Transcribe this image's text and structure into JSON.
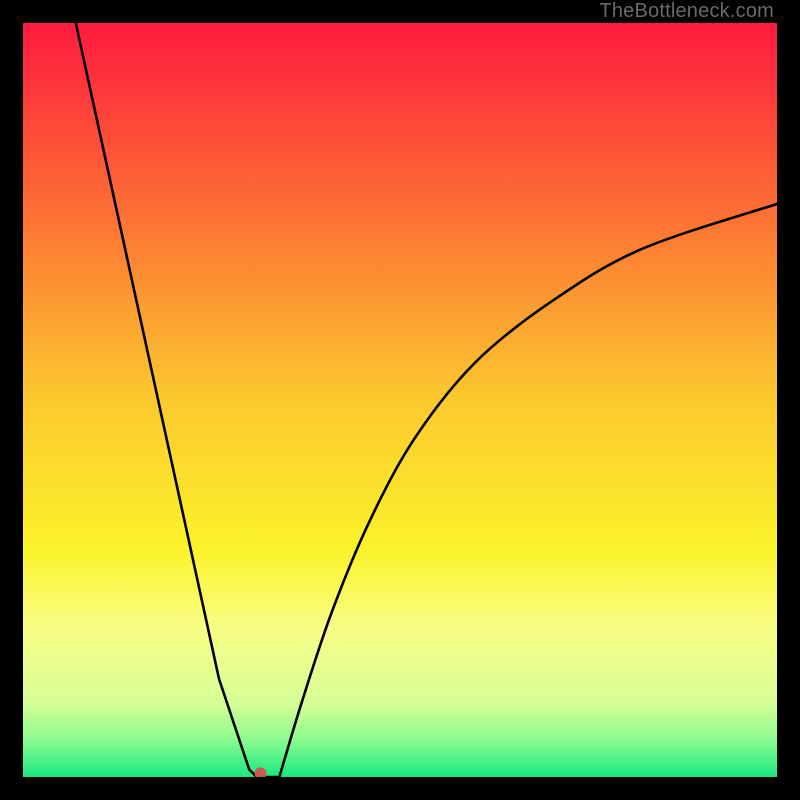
{
  "watermark": "TheBottleneck.com",
  "chart_data": {
    "type": "line",
    "title": "",
    "xlabel": "",
    "ylabel": "",
    "xlim": [
      0,
      100
    ],
    "ylim": [
      0,
      100
    ],
    "grid": false,
    "legend": false,
    "background_gradient": {
      "stops": [
        {
          "offset": 0.0,
          "color": "#ff1a3f"
        },
        {
          "offset": 0.25,
          "color": "#fd6f34"
        },
        {
          "offset": 0.5,
          "color": "#fcc92e"
        },
        {
          "offset": 0.7,
          "color": "#fbf32b"
        },
        {
          "offset": 0.8,
          "color": "#f9fe84"
        },
        {
          "offset": 0.9,
          "color": "#d7fe96"
        },
        {
          "offset": 0.95,
          "color": "#8dfc90"
        },
        {
          "offset": 1.0,
          "color": "#17e880"
        }
      ]
    },
    "series": [
      {
        "name": "bottleneck-curve",
        "description": "V-shaped curve: steep linear fall on left, flat bottom, concave-down rise on right",
        "x": [
          7,
          26,
          30,
          31,
          34,
          37,
          41,
          46,
          52,
          60,
          70,
          82,
          100
        ],
        "y": [
          100,
          13,
          1,
          0,
          0,
          10,
          22,
          34,
          45,
          55,
          63,
          70,
          76
        ]
      }
    ],
    "marker": {
      "name": "optimal-point",
      "x": 31.5,
      "y": 0.5,
      "color": "#c75a55",
      "radius": 6
    }
  }
}
